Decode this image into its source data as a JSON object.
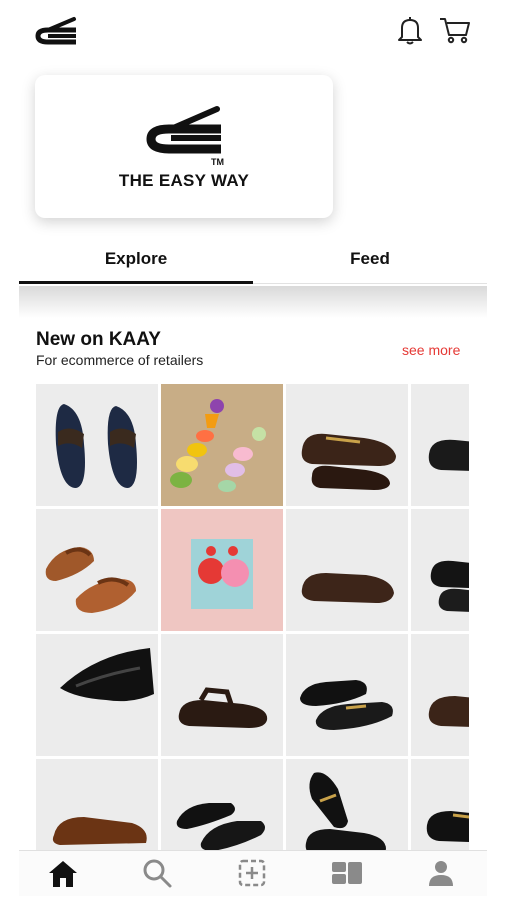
{
  "header": {
    "logo_icon": "brand-logo-icon",
    "actions": [
      "bell-icon",
      "cart-icon"
    ]
  },
  "brand": {
    "name": "THE EASY WAY",
    "trademark": "TM"
  },
  "tabs": [
    {
      "label": "Explore",
      "active": true
    },
    {
      "label": "Feed",
      "active": false
    }
  ],
  "section": {
    "title": "New on KAAY",
    "subtitle": "For ecommerce of retailers",
    "see_more": "see more"
  },
  "products": [
    "navy-peshawari-sandals",
    "colorful-clay-earrings",
    "brown-buckle-loafer",
    "black-loafer",
    "tan-peshawari-sandals",
    "pink-earrings-card",
    "brown-loafer",
    "black-shoes",
    "black-peshawari-chappal",
    "brown-sandal",
    "black-croc-loafers",
    "brown-shoe",
    "brown-strap-sandal",
    "black-sandals-pair",
    "black-buckle-loafers-pair",
    "black-buckle-loafer"
  ],
  "bottom_nav": [
    "home-icon",
    "search-icon",
    "add-post-icon",
    "feed-icon",
    "profile-icon"
  ],
  "colors": {
    "accent": "#e53935",
    "text": "#111111",
    "tile_bg": "#ececec"
  }
}
